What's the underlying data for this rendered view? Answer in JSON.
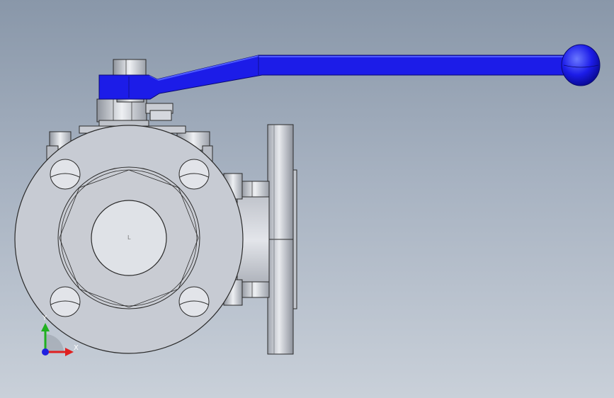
{
  "scene": {
    "type": "3d-cad-view",
    "subject": "flanged-ball-valve-assembly",
    "background_colors": [
      "#8997a9",
      "#c9d0d9"
    ],
    "part_color": "#c7cbd3",
    "edge_color": "#2b2b2b",
    "handle_color": "#1c1ce8",
    "handle_highlight": "#4f5cff"
  },
  "triad": {
    "x_label": "X",
    "y_label": "Y",
    "x_color": "#e02020",
    "y_color": "#20b020",
    "z_color": "#2020e0"
  }
}
